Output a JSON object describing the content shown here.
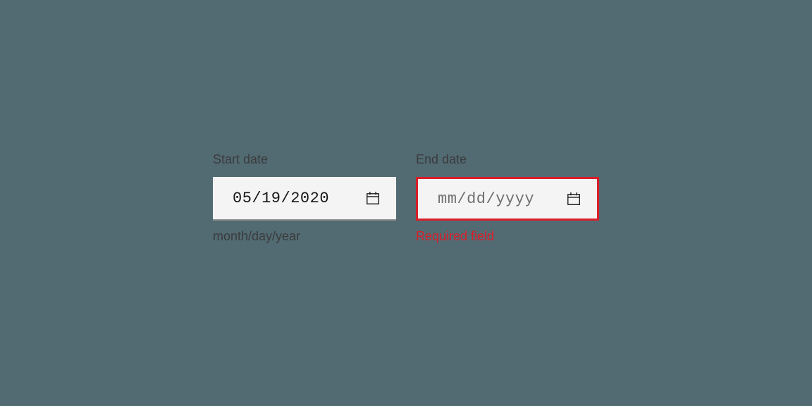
{
  "start": {
    "label": "Start date",
    "value": "05/19/2020",
    "helper": "month/day/year"
  },
  "end": {
    "label": "End date",
    "placeholder": "mm/dd/yyyy",
    "error": "Required field"
  }
}
